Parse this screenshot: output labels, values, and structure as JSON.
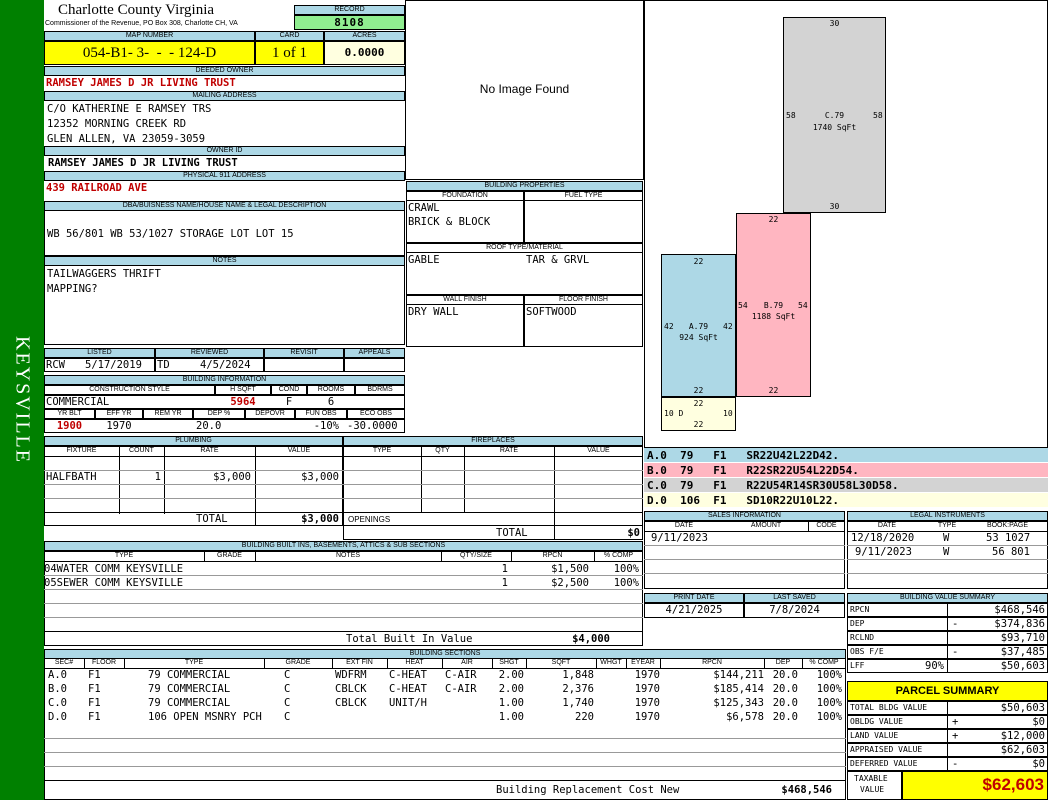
{
  "district": "KEYSVILLE",
  "county_title": "Charlotte County Virginia",
  "county_sub": "Commissioner of the Revenue, PO Box 308, Charlotte CH, VA",
  "record": {
    "label": "RECORD",
    "value": "8108"
  },
  "map": {
    "label": "MAP NUMBER",
    "value": "054-B1- 3-  -  - 124-D"
  },
  "card": {
    "label": "CARD",
    "value": "1 of 1"
  },
  "acres": {
    "label": "ACRES",
    "value": "0.0000"
  },
  "deeded_owner": {
    "label": "DEEDED OWNER",
    "value": "RAMSEY JAMES D JR LIVING TRUST"
  },
  "mailing": {
    "label": "MAILING ADDRESS",
    "line1": "C/O KATHERINE E RAMSEY TRS",
    "line2": "12352 MORNING CREEK RD",
    "line3": "GLEN ALLEN, VA 23059-3059"
  },
  "owner_id": {
    "label": "OWNER ID",
    "value": "RAMSEY JAMES D JR LIVING TRUST"
  },
  "physical_address": {
    "label": "PHYSICAL 911 ADDRESS",
    "value": "439 RAILROAD AVE"
  },
  "legal": {
    "label": "DBA/BUISNESS NAME/HOUSE NAME & LEGAL DESCRIPTION",
    "value": "WB 56/801 WB 53/1027 STORAGE LOT LOT 15"
  },
  "notes": {
    "label": "NOTES",
    "line1": "TAILWAGGERS THRIFT",
    "line2": "MAPPING?"
  },
  "photo": {
    "text": "No Image Found"
  },
  "bldg_props": {
    "label": "BUILDING PROPERTIES",
    "foundation_label": "FOUNDATION",
    "fuel_label": "FUEL TYPE",
    "foundation1": "CRAWL",
    "foundation2": "BRICK & BLOCK",
    "roof_label": "ROOF TYPE/MATERIAL",
    "roof_type": "GABLE",
    "roof_material": "TAR & GRVL",
    "wall_label": "WALL FINISH",
    "floor_label": "FLOOR FINISH",
    "wall": "DRY WALL",
    "floor": "SOFTWOOD"
  },
  "dates": {
    "listed_label": "LISTED",
    "reviewed_label": "REVIEWED",
    "revisit_label": "REVISIT",
    "appeals_label": "APPEALS",
    "listed_by": "RCW",
    "listed": "5/17/2019",
    "reviewed_by": "TD",
    "reviewed": "4/5/2024"
  },
  "bldg_info": {
    "label": "BUILDING INFORMATION",
    "construction_label": "CONSTRUCTION STYLE",
    "hsqft_label": "H SQFT",
    "cond_label": "COND",
    "rooms_label": "ROOMS",
    "bdrms_label": "BDRMS",
    "construction": "COMMERCIAL",
    "hsqft": "5964",
    "cond": "F",
    "rooms": "6",
    "yrblt_label": "YR BLT",
    "effyr_label": "EFF YR",
    "remyr_label": "REM YR",
    "dep_label": "DEP %",
    "depovr_label": "DEPOVR",
    "funobs_label": "FUN OBS",
    "ecoobs_label": "ECO OBS",
    "yrblt": "1900",
    "effyr": "1970",
    "dep": "20.0",
    "funobs": "-10%",
    "ecoobs": "-30.0000"
  },
  "plumbing": {
    "label": "PLUMBING",
    "cols": [
      "FIXTURE",
      "COUNT",
      "RATE",
      "VALUE"
    ],
    "rows": [
      {
        "fixture": "HALFBATH",
        "count": "1",
        "rate": "$3,000",
        "value": "$3,000"
      }
    ],
    "total_label": "TOTAL",
    "total": "$3,000"
  },
  "fireplaces": {
    "label": "FIREPLACES",
    "cols": [
      "TYPE",
      "QTY",
      "RATE",
      "VALUE"
    ],
    "openings_label": "OPENINGS",
    "total_label": "TOTAL",
    "total": "$0"
  },
  "builtins": {
    "label": "BUILDING BUILT INS, BASEMENTS, ATTICS & SUB SECTIONS",
    "cols": [
      "TYPE",
      "GRADE",
      "NOTES",
      "QTY/SIZE",
      "RPCN",
      "% COMP"
    ],
    "rows": [
      {
        "type": "04WATER COMM KEYSVILLE",
        "qty": "1",
        "rpcn": "$1,500",
        "comp": "100%"
      },
      {
        "type": "05SEWER COMM KEYSVILLE",
        "qty": "1",
        "rpcn": "$2,500",
        "comp": "100%"
      }
    ],
    "total_label": "Total Built In Value",
    "total": "$4,000"
  },
  "sections": {
    "label": "BUILDING SECTIONS",
    "cols": [
      "SEC#",
      "FLOOR",
      "TYPE",
      "GRADE",
      "EXT FIN",
      "HEAT",
      "AIR",
      "SHGT",
      "SQFT",
      "WHGT",
      "EYEAR",
      "RPCN",
      "DEP",
      "% COMP"
    ],
    "rows": [
      {
        "sec": "A.0",
        "floor": "F1",
        "type": "79 COMMERCIAL",
        "grade": "C",
        "ext": "WDFRM",
        "heat": "C-HEAT",
        "air": "C-AIR",
        "shgt": "2.00",
        "sqft": "1,848",
        "eyear": "1970",
        "rpcn": "$144,211",
        "dep": "20.0",
        "comp": "100%"
      },
      {
        "sec": "B.0",
        "floor": "F1",
        "type": "79 COMMERCIAL",
        "grade": "C",
        "ext": "CBLCK",
        "heat": "C-HEAT",
        "air": "C-AIR",
        "shgt": "2.00",
        "sqft": "2,376",
        "eyear": "1970",
        "rpcn": "$185,414",
        "dep": "20.0",
        "comp": "100%"
      },
      {
        "sec": "C.0",
        "floor": "F1",
        "type": "79 COMMERCIAL",
        "grade": "C",
        "ext": "CBLCK",
        "heat": "UNIT/H",
        "air": "",
        "shgt": "1.00",
        "sqft": "1,740",
        "eyear": "1970",
        "rpcn": "$125,343",
        "dep": "20.0",
        "comp": "100%"
      },
      {
        "sec": "D.0",
        "floor": "F1",
        "type": "106 OPEN MSNRY PCH",
        "grade": "C",
        "ext": "",
        "heat": "",
        "air": "",
        "shgt": "1.00",
        "sqft": "220",
        "eyear": "1970",
        "rpcn": "$6,578",
        "dep": "20.0",
        "comp": "100%"
      }
    ],
    "replacement_label": "Building Replacement Cost New",
    "replacement": "$468,546"
  },
  "sketch": {
    "c_label": "C.79",
    "c_area": "1740 SqFt",
    "c_top": "30",
    "c_bottom": "30",
    "c_left": "58",
    "c_right": "58",
    "b_label": "B.79",
    "b_area": "1188 SqFt",
    "b_top": "22",
    "b_bottom": "22",
    "b_left": "54",
    "b_right": "54",
    "a_label": "A.79",
    "a_area": "924 SqFt",
    "a_top": "22",
    "a_bottom": "22",
    "a_left": "42",
    "a_right": "42",
    "d_label": "10 D",
    "d_top": "22",
    "d_bottom": "22",
    "d_right": "10",
    "colors": {
      "a": "#add8e6",
      "b": "#ffb6c1",
      "c": "#d3d3d3",
      "d": "#ffffe0"
    }
  },
  "vectors": [
    {
      "text": "A.0  79   F1   SR22U42L22D42.",
      "color": "#add8e6"
    },
    {
      "text": "B.0  79   F1   R22SR22U54L22D54.",
      "color": "#ffb6c1"
    },
    {
      "text": "C.0  79   F1   R22U54R14SR30U58L30D58.",
      "color": "#d3d3d3"
    },
    {
      "text": "D.0  106  F1   SD10R22U10L22.",
      "color": "#ffffe0"
    }
  ],
  "sales": {
    "label": "SALES INFORMATION",
    "cols": [
      "DATE",
      "AMOUNT",
      "CODE"
    ],
    "rows": [
      {
        "date": "9/11/2023",
        "amount": "",
        "code": ""
      }
    ]
  },
  "legal_instruments": {
    "label": "LEGAL INSTRUMENTS",
    "cols": [
      "DATE",
      "TYPE",
      "BOOK:PAGE"
    ],
    "rows": [
      {
        "date": "12/18/2020",
        "type": "W",
        "book": "53 1027"
      },
      {
        "date": "9/11/2023",
        "type": "W",
        "book": "56 801"
      }
    ]
  },
  "print": {
    "print_label": "PRINT DATE",
    "saved_label": "LAST SAVED",
    "print_date": "4/21/2025",
    "last_saved": "7/8/2024"
  },
  "value_summary": {
    "label": "BUILDING VALUE SUMMARY",
    "rows": [
      {
        "label": "RPCN",
        "sign": "",
        "value": "$468,546"
      },
      {
        "label": "DEP",
        "sign": "-",
        "value": "$374,836"
      },
      {
        "label": "RCLND",
        "sign": "",
        "value": "$93,710"
      },
      {
        "label": "OBS F/E",
        "sign": "-",
        "value": "$37,485"
      },
      {
        "label": "LFF",
        "pct": "90%",
        "sign": "",
        "value": "$50,603"
      }
    ]
  },
  "parcel": {
    "label": "PARCEL SUMMARY",
    "rows": [
      {
        "label": "TOTAL BLDG VALUE",
        "sign": "",
        "value": "$50,603"
      },
      {
        "label": "OBLDG VALUE",
        "sign": "+",
        "value": "$0"
      },
      {
        "label": "LAND VALUE",
        "sign": "+",
        "value": "$12,000"
      },
      {
        "label": "APPRAISED VALUE",
        "sign": "",
        "value": "$62,603"
      },
      {
        "label": "DEFERRED VALUE",
        "sign": "-",
        "value": "$0"
      }
    ],
    "taxable_label1": "TAXABLE",
    "taxable_label2": "VALUE",
    "taxable": "$62,603"
  }
}
